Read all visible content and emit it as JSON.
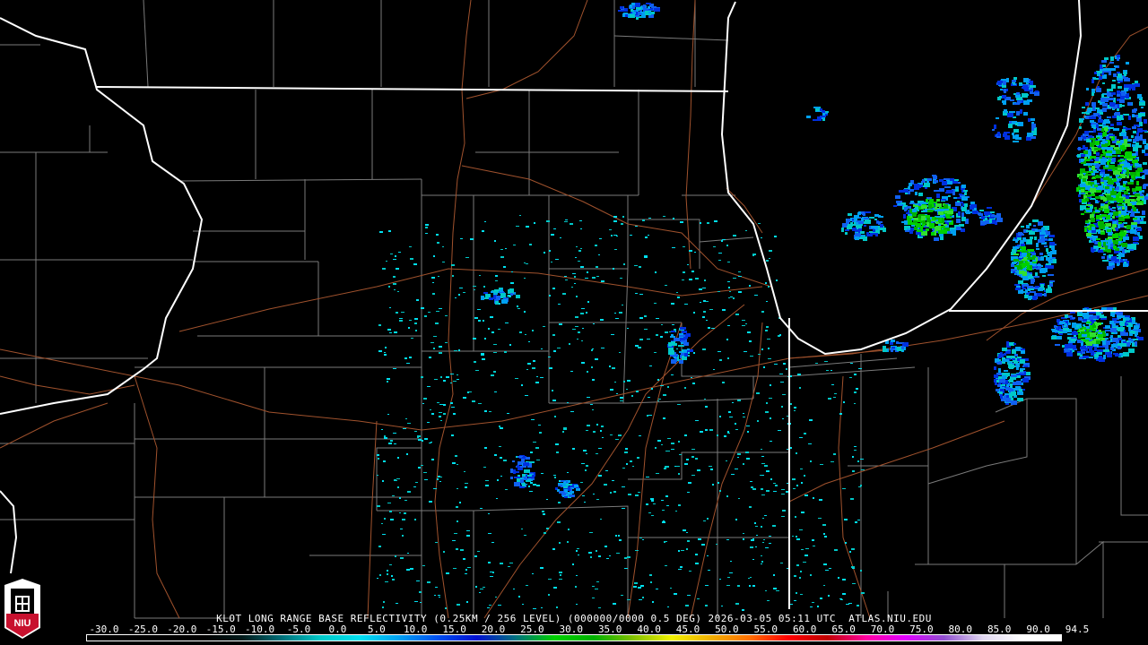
{
  "product_title": "KLOT LONG RANGE BASE REFLECTIVITY (0.25KM / 256 LEVEL) (000000/0000 0.5 DEG) 2026-03-05 05:11 UTC  ATLAS.NIU.EDU",
  "logo_text": "NIU",
  "legend": {
    "unit_ticks": [
      "-30.0",
      "-25.0",
      "-20.0",
      "-15.0",
      "-10.0",
      "-5.0",
      "0.0",
      "5.0",
      "10.0",
      "15.0",
      "20.0",
      "25.0",
      "30.0",
      "35.0",
      "40.0",
      "45.0",
      "50.0",
      "55.0",
      "60.0",
      "65.0",
      "70.0",
      "75.0",
      "80.0",
      "85.0",
      "90.0",
      "94.5"
    ],
    "range": [
      -30,
      94.5
    ],
    "colors": [
      "#000000",
      "#000000",
      "#000000",
      "#000000",
      "#001a1a",
      "#00707a",
      "#00c8c8",
      "#00e0f0",
      "#00a0f0",
      "#0050f0",
      "#0010d0",
      "#007080",
      "#00d000",
      "#00b000",
      "#80c000",
      "#f0f000",
      "#f0b000",
      "#ff7000",
      "#ff0000",
      "#c00000",
      "#ff00a0",
      "#e000ff",
      "#9050d0",
      "#e0d8f0",
      "#ffffff",
      "#ffffff"
    ]
  },
  "colors": {
    "road": "#a0522d",
    "county": "#808080",
    "state": "#ffffff"
  }
}
